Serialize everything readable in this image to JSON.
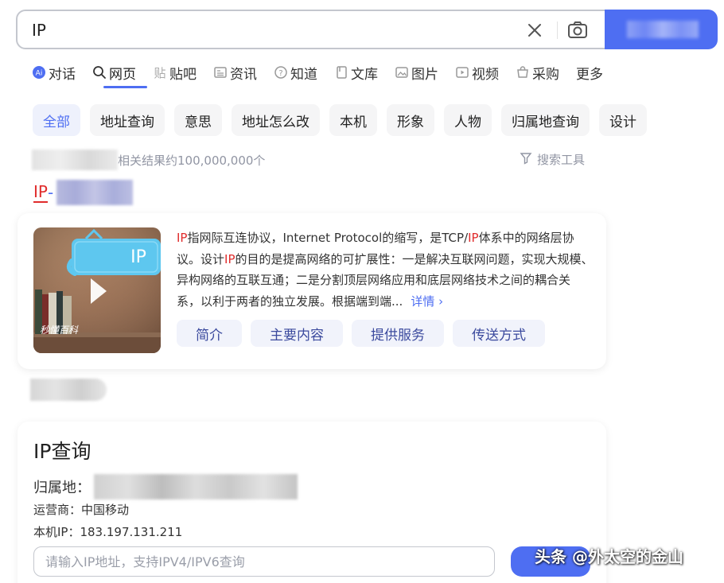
{
  "search": {
    "query": "IP"
  },
  "tabs": [
    {
      "label": "对话",
      "icon": "ai-chat-icon"
    },
    {
      "label": "网页",
      "icon": "search-icon",
      "active": true
    },
    {
      "label": "贴吧",
      "icon": "tieba-icon"
    },
    {
      "label": "资讯",
      "icon": "news-icon"
    },
    {
      "label": "知道",
      "icon": "question-icon"
    },
    {
      "label": "文库",
      "icon": "document-icon"
    },
    {
      "label": "图片",
      "icon": "image-icon"
    },
    {
      "label": "视频",
      "icon": "video-icon"
    },
    {
      "label": "采购",
      "icon": "purchase-icon"
    },
    {
      "label": "更多",
      "icon": ""
    }
  ],
  "chips": [
    "全部",
    "地址查询",
    "意思",
    "地址怎么改",
    "本机",
    "形象",
    "人物",
    "归属地查询",
    "设计"
  ],
  "results": {
    "count_text": "相关结果约100,000,000个",
    "tools_label": "搜索工具"
  },
  "result1": {
    "title_prefix": "IP",
    "title_dash": " -",
    "thumb_label": "IP",
    "thumb_brand": "秒懂百科",
    "desc_parts": [
      {
        "t": "IP",
        "hl": true
      },
      {
        "t": "指网际互连协议，Internet Protocol的缩写，是TCP/",
        "hl": false
      },
      {
        "t": "IP",
        "hl": true
      },
      {
        "t": "体系中的网络层协议。设计",
        "hl": false
      },
      {
        "t": "IP",
        "hl": true
      },
      {
        "t": "的目的是提高网络的可扩展性：一是解决互联网问题，实现大规模、异构网络的互联互通；二是分割顶层网络应用和底层网络技术之间的耦合关系，以利于两者的独立发展。根据端到端...",
        "hl": false
      }
    ],
    "more_label": "详情",
    "buttons": [
      "简介",
      "主要内容",
      "提供服务",
      "传送方式"
    ]
  },
  "ipcard": {
    "title": "IP查询",
    "location_label": "归属地：",
    "carrier_text": "运营商：中国移动",
    "local_ip_text": "本机IP：183.197.131.211",
    "input_placeholder": "请输入IP地址，支持IPV4/IPV6查询"
  },
  "watermark": "头条 @外太空的金山",
  "colors": {
    "accent": "#4e6ef2",
    "highlight": "#e02c2c",
    "muted": "#9195a3"
  }
}
